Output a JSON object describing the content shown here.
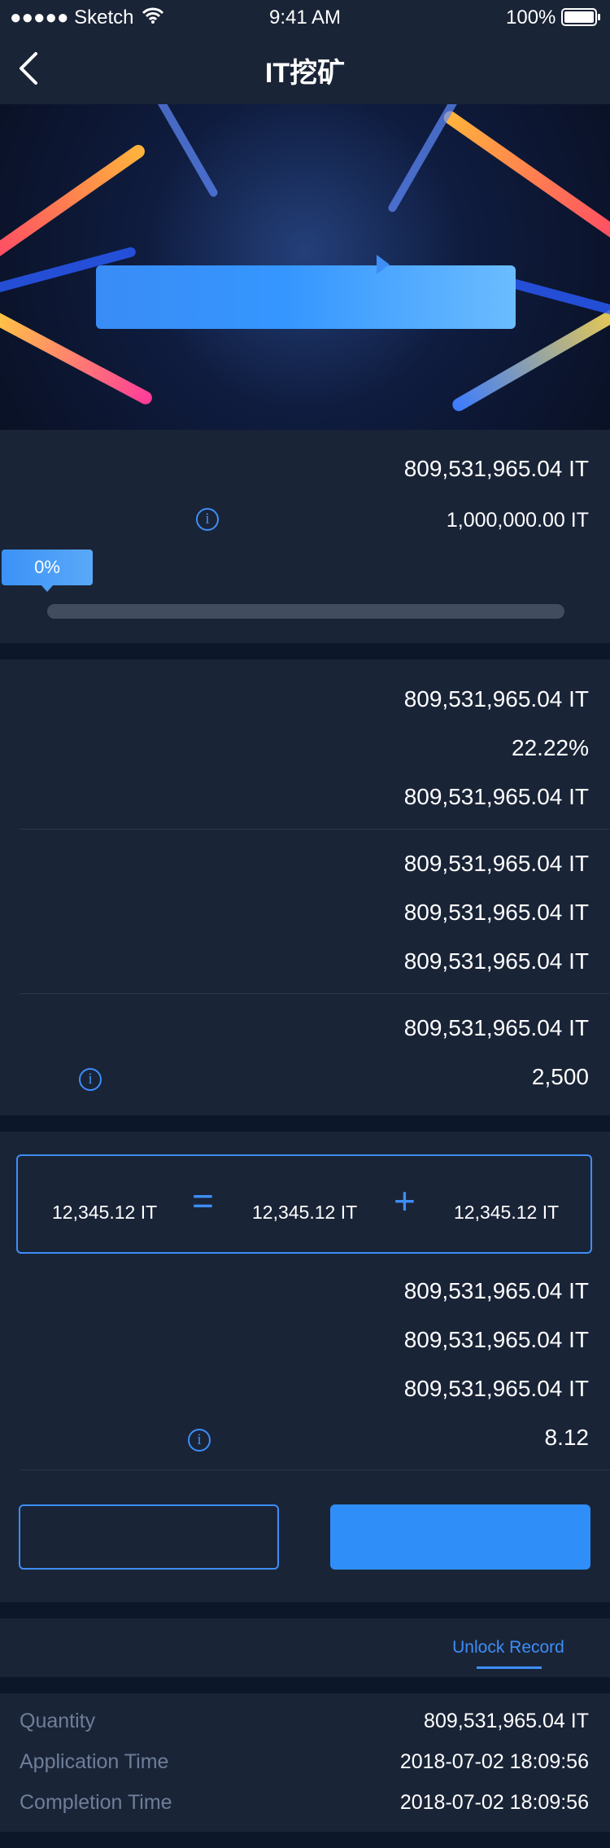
{
  "status_bar": {
    "carrier": "●●●●● Sketch",
    "time": "9:41 AM",
    "battery": "100%"
  },
  "nav": {
    "title": "IT挖矿"
  },
  "progress": {
    "amount_top": "809,531,965.04 IT",
    "amount_total": "1,000,000.00 IT",
    "percent_label": "0%",
    "fill_percent": 0
  },
  "stats_group_1": [
    "809,531,965.04 IT",
    "22.22%",
    "809,531,965.04 IT"
  ],
  "stats_group_2": [
    "809,531,965.04 IT",
    "809,531,965.04 IT",
    "809,531,965.04 IT"
  ],
  "stats_group_3": {
    "amount": "809,531,965.04 IT",
    "count": "2,500"
  },
  "formula": {
    "total": "12,345.12 IT",
    "equals": "=",
    "part_a": "12,345.12 IT",
    "plus": "+",
    "part_b": "12,345.12 IT"
  },
  "stats_group_4": [
    "809,531,965.04 IT",
    "809,531,965.04 IT",
    "809,531,965.04 IT"
  ],
  "rate": "8.12",
  "tabs": {
    "unlock_record": "Unlock Record"
  },
  "record": {
    "quantity_label": "Quantity",
    "quantity_value": "809,531,965.04 IT",
    "application_time_label": "Application Time",
    "application_time_value": "2018-07-02 18:09:56",
    "completion_time_label": "Completion Time",
    "completion_time_value": "2018-07-02 18:09:56"
  },
  "colors": {
    "accent": "#3d8ef7",
    "panel": "#1a2437",
    "background": "#0c1729"
  },
  "icons": [
    "back-chevron-icon",
    "wifi-icon",
    "battery-icon",
    "info-icon",
    "play-icon"
  ]
}
